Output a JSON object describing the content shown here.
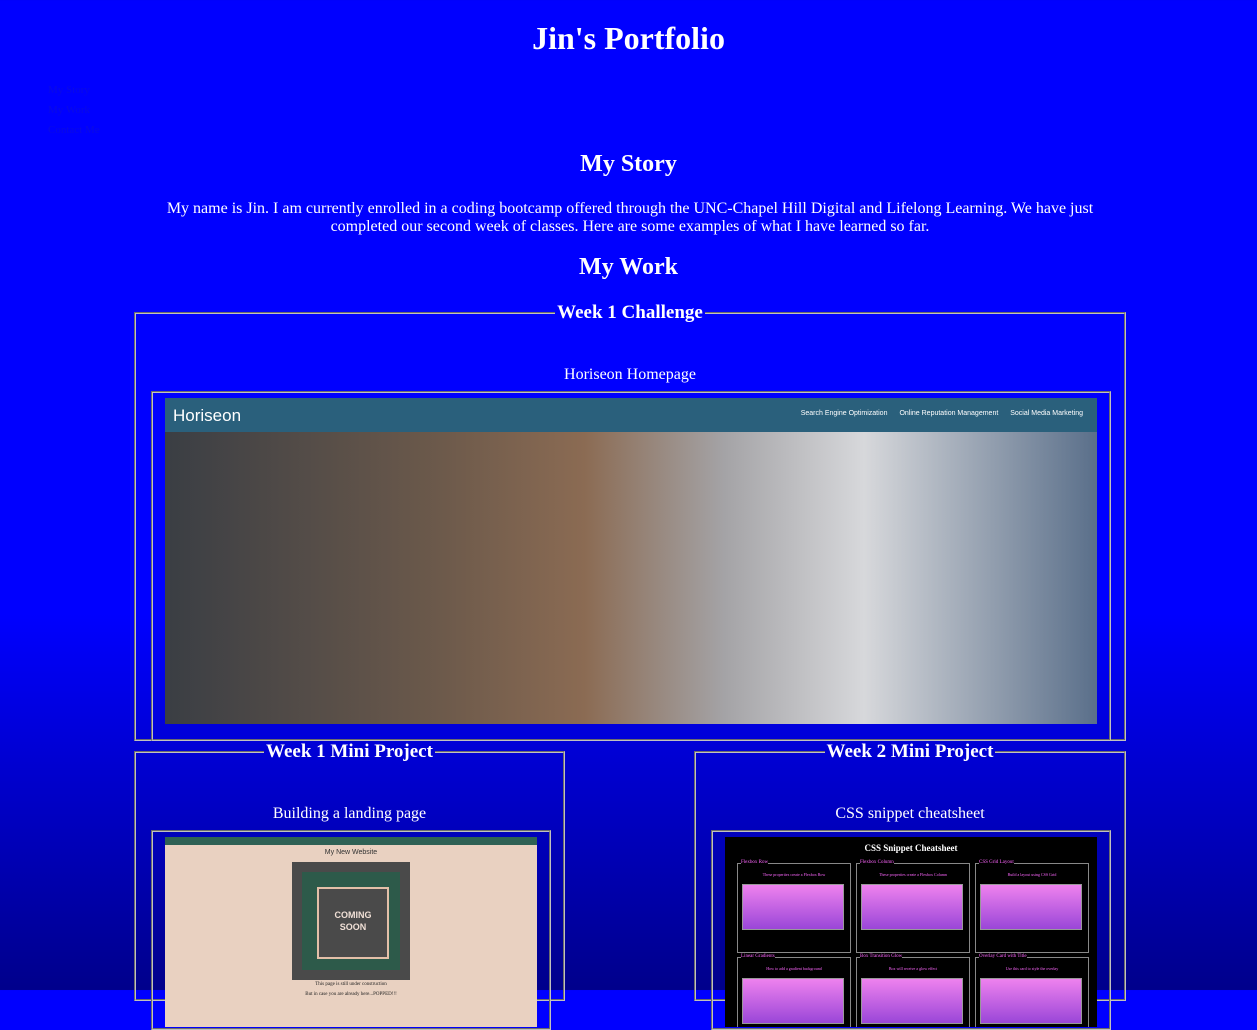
{
  "page": {
    "title": "Jin's Portfolio",
    "nav_items": [
      "My Story",
      "My Work",
      "Contact Me"
    ]
  },
  "story": {
    "heading": "My Story",
    "text": "My name is Jin. I am currently enrolled in a coding bootcamp offered through the UNC-Chapel Hill Digital and Lifelong Learning. We have just completed our second week of classes. Here are some examples of what I have learned so far."
  },
  "work": {
    "heading": "My Work",
    "projects": [
      {
        "legend": "Week 1 Challenge",
        "caption": "Horiseon Homepage"
      },
      {
        "legend": "Week 1 Mini Project",
        "caption": "Building a landing page"
      },
      {
        "legend": "Week 2 Mini Project",
        "caption": "CSS snippet cheatsheet"
      }
    ]
  },
  "horiseon_shot": {
    "logo": "Horiseon",
    "nav": [
      "Search Engine Optimization",
      "Online Reputation Management",
      "Social Media Marketing"
    ]
  },
  "landing_shot": {
    "title": "My New Website",
    "badge_line1": "COMING",
    "badge_line2": "SOON",
    "line1": "This page is still under construction",
    "line2": "But in case you are already here...POPPED!!!"
  },
  "cheatsheet_shot": {
    "title": "CSS Snippet Cheatsheet",
    "cards": [
      {
        "label": "Flexbox Row",
        "text": "These properties create a Flexbox Row"
      },
      {
        "label": "Flexbox Column",
        "text": "These properties create a Flexbox Column"
      },
      {
        "label": "CSS Grid Layout",
        "text": "Build a layout using CSS Grid"
      },
      {
        "label": "Linear Gradients",
        "text": "How to add a gradient background"
      },
      {
        "label": "Box Transition Glow",
        "text": "Box will receive a glow effect"
      },
      {
        "label": "Overlay Card with Title",
        "text": "Use this card to style the overlay"
      }
    ]
  },
  "colors": {
    "background": "#0000ff",
    "background_bottom": "#00008b",
    "text": "#ffffff",
    "horiseon_bar": "#2a607c"
  }
}
